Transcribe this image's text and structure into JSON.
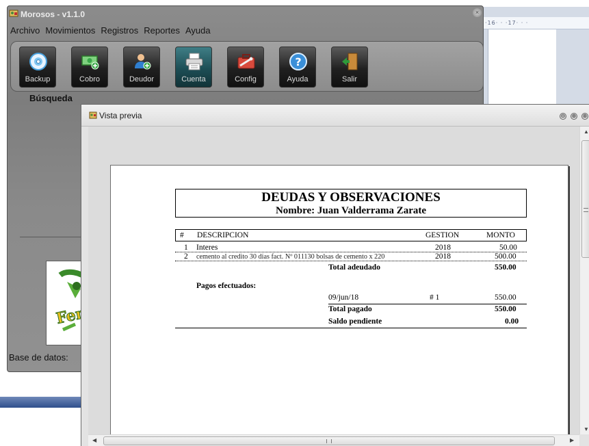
{
  "background_doc": {
    "ruler_text": "·16·  ·  ·17·  ·  ·"
  },
  "main_window": {
    "title": "Morosos - v1.1.0",
    "close_glyph": "×",
    "menu": [
      "Archivo",
      "Movimientos",
      "Registros",
      "Reportes",
      "Ayuda"
    ],
    "toolbar": [
      {
        "label": "Backup",
        "icon": "disc-icon",
        "color": "#4aa3e0"
      },
      {
        "label": "Cobro",
        "icon": "cash-icon",
        "color": "#3aa84a"
      },
      {
        "label": "Deudor",
        "icon": "user-add-icon",
        "color": "#2f7fd0"
      },
      {
        "label": "Cuenta",
        "icon": "printer-icon",
        "color": "#3c9fa8"
      },
      {
        "label": "Config",
        "icon": "toolbox-icon",
        "color": "#d84a3c"
      },
      {
        "label": "Ayuda",
        "icon": "help-icon",
        "color": "#3a8fd8"
      },
      {
        "label": "Salir",
        "icon": "exit-door-icon",
        "color": "#2e9a3a"
      }
    ],
    "search_label": "Búsqueda",
    "logo_text": "Ferre",
    "db_label": "Base de datos:"
  },
  "preview_window": {
    "title": "Vista previa",
    "buttons": [
      "⊖",
      "⊕",
      "⊗"
    ],
    "scroll_grip": "III"
  },
  "report": {
    "title": "DEUDAS Y OBSERVACIONES",
    "subtitle": "Nombre: Juan Valderrama Zarate",
    "columns": {
      "num": "#",
      "desc": "DESCRIPCION",
      "gestion": "GESTION",
      "monto": "MONTO"
    },
    "items": [
      {
        "num": "1",
        "desc": "Interes",
        "gestion": "2018",
        "monto": "50.00"
      },
      {
        "num": "2",
        "desc": "cemento al credito 30 dias fact. Nº 011130 bolsas de cemento x 220",
        "gestion": "2018",
        "monto": "500.00"
      }
    ],
    "total_owed_label": "Total adeudado",
    "total_owed": "550.00",
    "payments_label": "Pagos efectuados:",
    "payments": [
      {
        "date": "09/jun/18",
        "num": "# 1",
        "monto": "550.00"
      }
    ],
    "total_paid_label": "Total pagado",
    "total_paid": "550.00",
    "balance_label": "Saldo pendiente",
    "balance": "0.00"
  }
}
